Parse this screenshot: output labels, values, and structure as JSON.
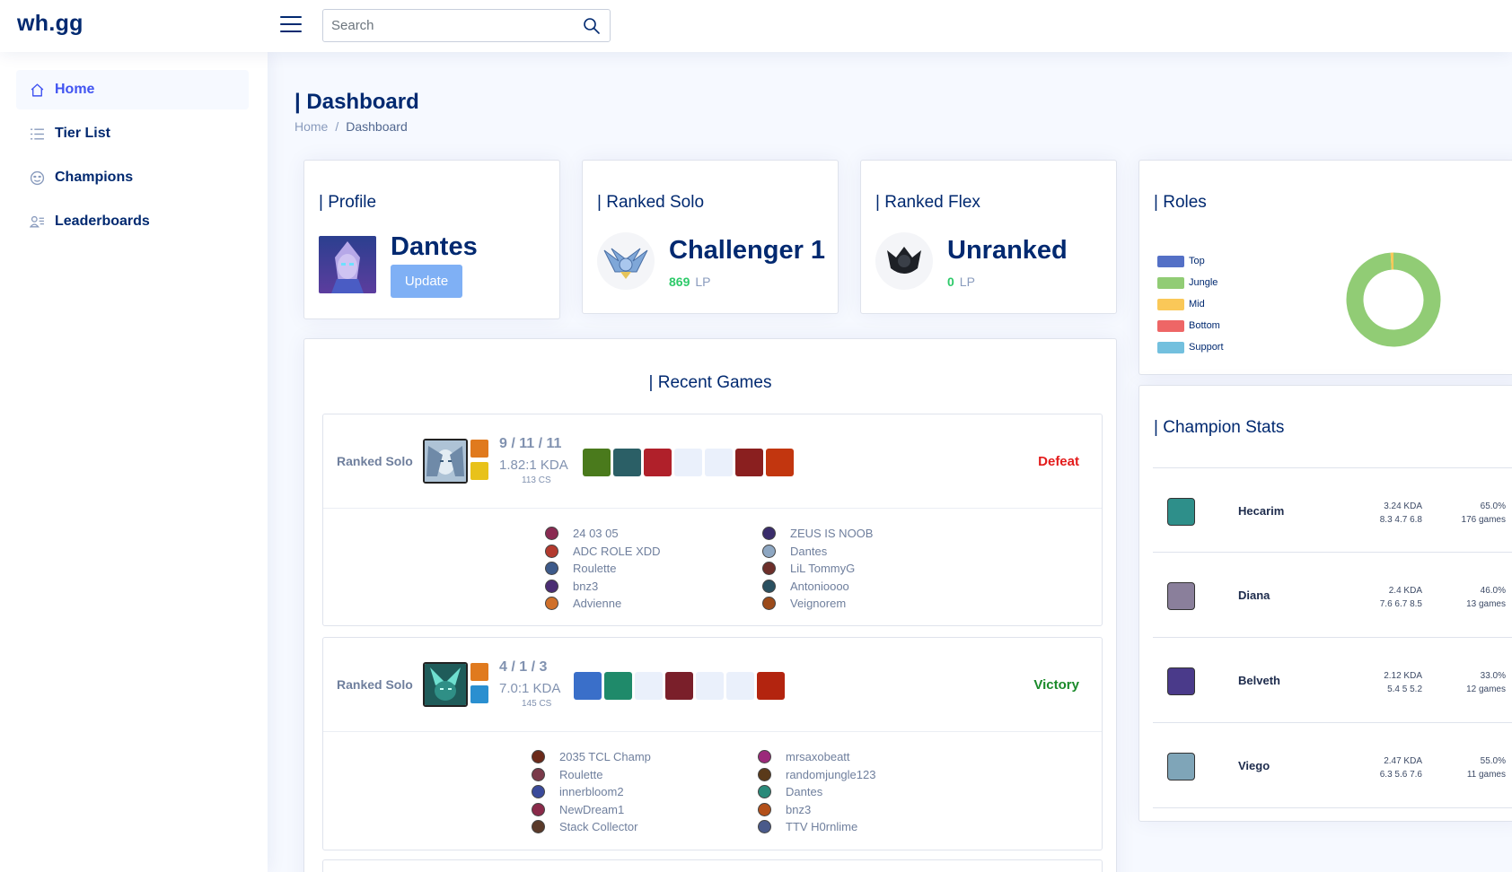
{
  "header": {
    "logo": "wh.gg",
    "search_placeholder": "Search"
  },
  "sidebar": {
    "items": [
      {
        "label": "Home",
        "icon": "house-icon",
        "active": true
      },
      {
        "label": "Tier List",
        "icon": "list-icon",
        "active": false
      },
      {
        "label": "Champions",
        "icon": "smiley-icon",
        "active": false
      },
      {
        "label": "Leaderboards",
        "icon": "people-icon",
        "active": false
      }
    ]
  },
  "page": {
    "title": "| Dashboard",
    "breadcrumb": [
      "Home",
      "/",
      "Dashboard"
    ]
  },
  "profile": {
    "title": "Profile",
    "name": "Dantes",
    "update_label": "Update"
  },
  "ranked_solo": {
    "title": "Ranked Solo",
    "rank": "Challenger 1",
    "lp": "869",
    "lp_unit": "LP"
  },
  "ranked_flex": {
    "title": "Ranked Flex",
    "rank": "Unranked",
    "lp": "0",
    "lp_unit": "LP"
  },
  "roles": {
    "title": "Roles",
    "legend": [
      {
        "name": "Top",
        "color": "#5470c6"
      },
      {
        "name": "Jungle",
        "color": "#91cc75"
      },
      {
        "name": "Mid",
        "color": "#fac858"
      },
      {
        "name": "Bottom",
        "color": "#ee6666"
      },
      {
        "name": "Support",
        "color": "#73c0de"
      }
    ],
    "chart_data": {
      "type": "pie",
      "categories": [
        "Top",
        "Jungle",
        "Mid",
        "Bottom",
        "Support"
      ],
      "values": [
        0,
        99,
        1,
        0,
        0
      ],
      "donut": true
    }
  },
  "recent_games": {
    "title": "Recent Games",
    "games": [
      {
        "queue": "Ranked Solo",
        "kda": "9 / 11 / 11",
        "ratio": "1.82:1 KDA",
        "cs": "113 CS",
        "result": "Defeat",
        "champion_color": "#9fb6cc",
        "spells": [
          "#e07a1e",
          "#e8c21a"
        ],
        "items": [
          "#4a7a1c",
          "#2b5f66",
          "#b0202a",
          "empty",
          "empty",
          "#8a1f1f",
          "#c2360f"
        ],
        "team_left": [
          {
            "name": "24 03 05",
            "color": "#8a2b52"
          },
          {
            "name": "ADC ROLE XDD",
            "color": "#b33a2e"
          },
          {
            "name": "Roulette",
            "color": "#3d5a8a"
          },
          {
            "name": "bnz3",
            "color": "#4b2d73"
          },
          {
            "name": "Advienne",
            "color": "#d0702a"
          }
        ],
        "team_right": [
          {
            "name": "ZEUS IS NOOB",
            "color": "#3a2d6b"
          },
          {
            "name": "Dantes",
            "color": "#8ea7c2"
          },
          {
            "name": "LiL TommyG",
            "color": "#6d2f2a"
          },
          {
            "name": "Antonioooo",
            "color": "#2a5060"
          },
          {
            "name": "Veignorem",
            "color": "#9b4a1a"
          }
        ]
      },
      {
        "queue": "Ranked Solo",
        "kda": "4 / 1 / 3",
        "ratio": "7.0:1 KDA",
        "cs": "145 CS",
        "result": "Victory",
        "champion_color": "#1f6b66",
        "spells": [
          "#e07a1e",
          "#2a8fd0"
        ],
        "items": [
          "#3a6fc9",
          "#1f8a6a",
          "empty",
          "#7a1f2a",
          "empty",
          "empty",
          "#b3240f"
        ],
        "team_left": [
          {
            "name": "2035 TCL Champ",
            "color": "#6b2a1a"
          },
          {
            "name": "Roulette",
            "color": "#7a3a4a"
          },
          {
            "name": "innerbloom2",
            "color": "#3a4a9b"
          },
          {
            "name": "NewDream1",
            "color": "#8a2a4a"
          },
          {
            "name": "Stack Collector",
            "color": "#5a3a2a"
          }
        ],
        "team_right": [
          {
            "name": "mrsaxobeatt",
            "color": "#9b2a7a"
          },
          {
            "name": "randomjungle123",
            "color": "#5a3a1a"
          },
          {
            "name": "Dantes",
            "color": "#2a8a7a"
          },
          {
            "name": "bnz3",
            "color": "#b3501a"
          },
          {
            "name": "TTV H0rnlime",
            "color": "#4a5a8a"
          }
        ]
      }
    ]
  },
  "champion_stats": {
    "title": "Champion Stats",
    "rows": [
      {
        "name": "Hecarim",
        "kda": "3.24 KDA",
        "kda_detail": "8.3 4.7 6.8",
        "winrate": "65.0%",
        "games": "176 games",
        "color": "#2e8f8a"
      },
      {
        "name": "Diana",
        "kda": "2.4 KDA",
        "kda_detail": "7.6 6.7 8.5",
        "winrate": "46.0%",
        "games": "13 games",
        "color": "#8a7f9b"
      },
      {
        "name": "Belveth",
        "kda": "2.12 KDA",
        "kda_detail": "5.4 5 5.2",
        "winrate": "33.0%",
        "games": "12 games",
        "color": "#4a3a8a"
      },
      {
        "name": "Viego",
        "kda": "2.47 KDA",
        "kda_detail": "6.3 5.6 7.6",
        "winrate": "55.0%",
        "games": "11 games",
        "color": "#7fa5b8"
      }
    ]
  }
}
